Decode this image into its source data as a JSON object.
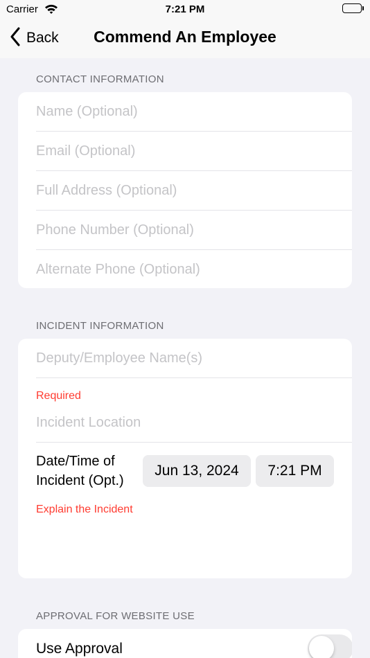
{
  "status_bar": {
    "carrier": "Carrier",
    "time": "7:21 PM"
  },
  "nav": {
    "back_label": "Back",
    "title": "Commend An Employee"
  },
  "contact": {
    "header": "CONTACT INFORMATION",
    "fields": [
      {
        "placeholder": "Name (Optional)",
        "value": ""
      },
      {
        "placeholder": "Email (Optional)",
        "value": ""
      },
      {
        "placeholder": "Full Address (Optional)",
        "value": ""
      },
      {
        "placeholder": "Phone Number (Optional)",
        "value": ""
      },
      {
        "placeholder": "Alternate Phone (Optional)",
        "value": ""
      }
    ]
  },
  "incident": {
    "header": "INCIDENT INFORMATION",
    "employee_field": {
      "placeholder": "Deputy/Employee Name(s)",
      "value": ""
    },
    "required_error": "Required",
    "location_field": {
      "placeholder": "Incident Location",
      "value": ""
    },
    "datetime_label_line1": "Date/Time of",
    "datetime_label_line2": "Incident (Opt.)",
    "date_value": "Jun 13, 2024",
    "time_value": "7:21 PM",
    "explain_error": "Explain the Incident",
    "explain_value": ""
  },
  "approval": {
    "header": "APPROVAL FOR WEBSITE USE",
    "use_approval_label": "Use Approval",
    "use_approval_on": false
  },
  "colors": {
    "background": "#f2f2f7",
    "error": "#ff3b30",
    "placeholder": "#c4c4c7",
    "pill": "#ececee"
  }
}
